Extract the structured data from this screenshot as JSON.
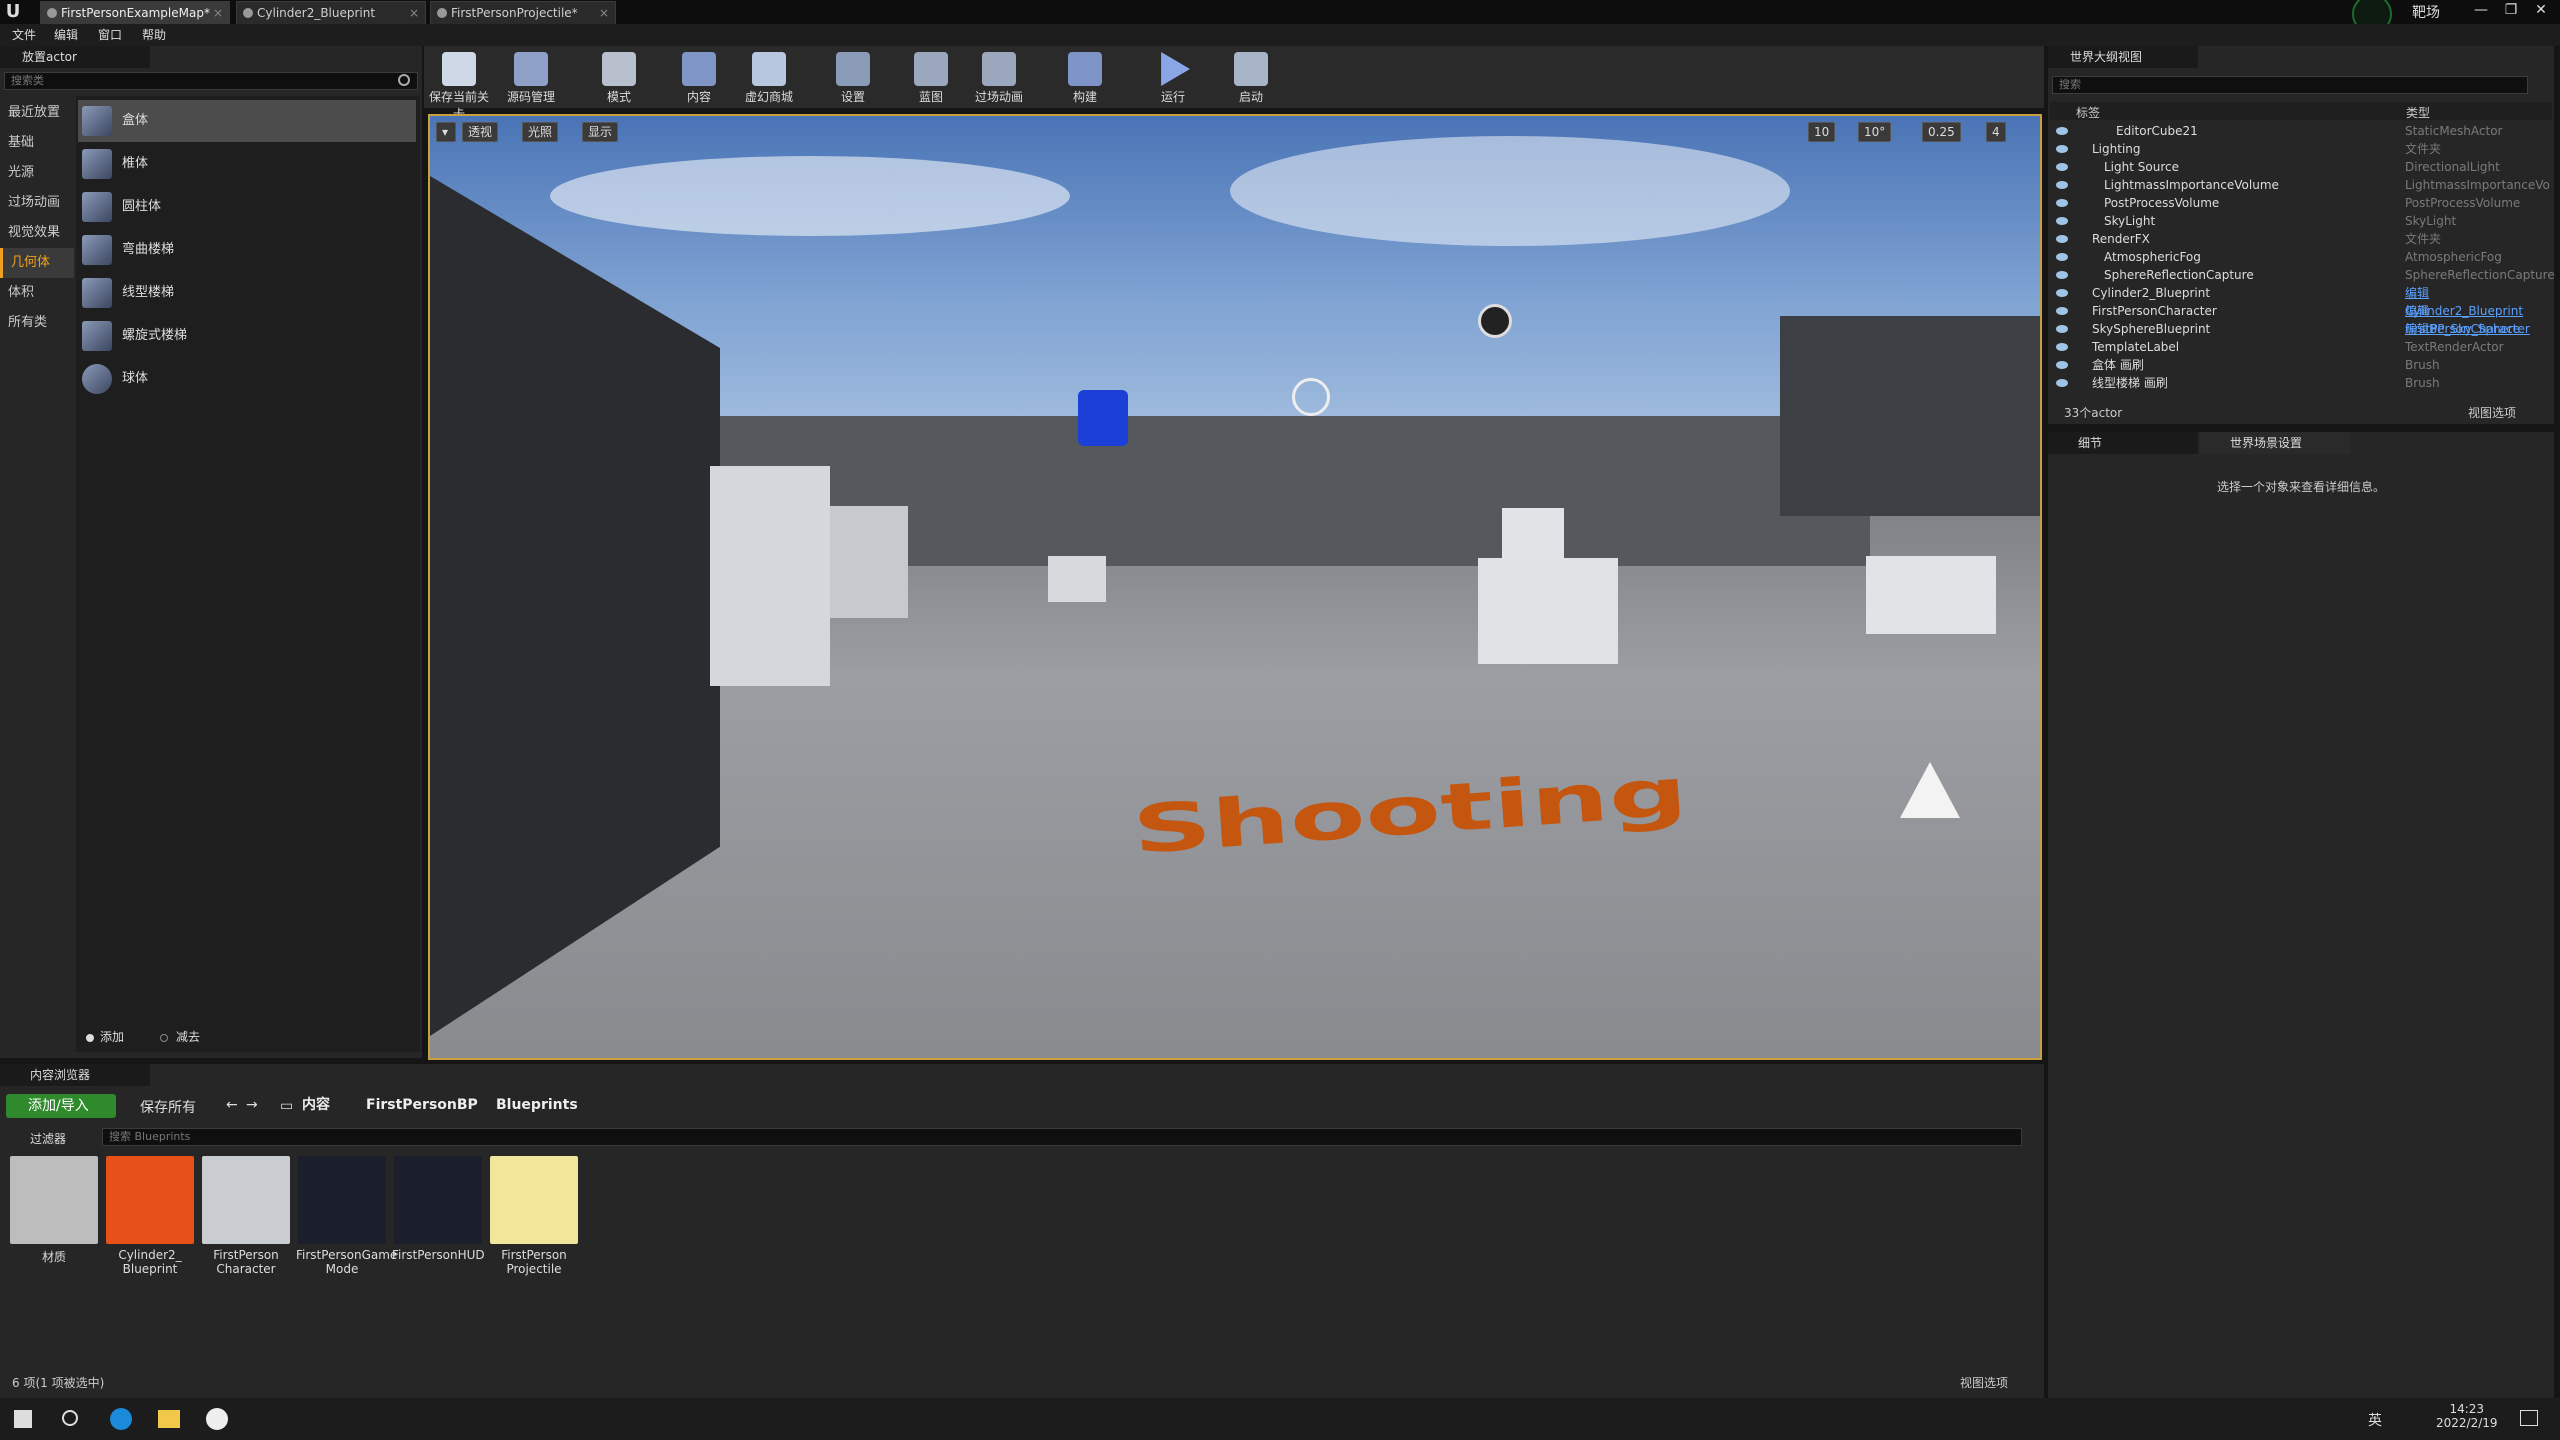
{
  "window": {
    "logo": "U",
    "tabs": [
      {
        "label": "FirstPersonExampleMap*"
      },
      {
        "label": "Cylinder2_Blueprint"
      },
      {
        "label": "FirstPersonProjectile*"
      }
    ],
    "project_label": "靶场",
    "controls": [
      "—",
      "❐",
      "✕"
    ]
  },
  "menu": {
    "items": [
      "文件",
      "编辑",
      "窗口",
      "帮助"
    ]
  },
  "place_panel": {
    "tab": "放置actor",
    "search_placeholder": "搜索类",
    "categories": [
      "最近放置",
      "基础",
      "光源",
      "过场动画",
      "视觉效果",
      "几何体",
      "体积",
      "所有类"
    ],
    "selected_category": "几何体",
    "items": [
      "盒体",
      "椎体",
      "圆柱体",
      "弯曲楼梯",
      "线型楼梯",
      "螺旋式楼梯",
      "球体"
    ],
    "add_label": "添加",
    "subtract_label": "减去"
  },
  "toolbar": {
    "buttons": [
      "保存当前关卡",
      "源码管理",
      "模式",
      "内容",
      "虚幻商城",
      "设置",
      "蓝图",
      "过场动画",
      "构建",
      "运行",
      "启动"
    ]
  },
  "viewport": {
    "perspective": "透视",
    "lit": "光照",
    "show": "显示",
    "grid": "10",
    "rotation": "10°",
    "scale": "0.25",
    "camera_speed": "4",
    "floor_text": "Shooting"
  },
  "outliner": {
    "tab": "世界大纲视图",
    "search_placeholder": "搜索",
    "col_label": "标签",
    "col_type": "类型",
    "rows": [
      {
        "name": "EditorCube21",
        "type": "StaticMeshActor",
        "indent": 3
      },
      {
        "name": "Lighting",
        "type": "文件夹",
        "indent": 1,
        "folder": true
      },
      {
        "name": "Light Source",
        "type": "DirectionalLight",
        "indent": 2
      },
      {
        "name": "LightmassImportanceVolume",
        "type": "LightmassImportanceVo",
        "indent": 2
      },
      {
        "name": "PostProcessVolume",
        "type": "PostProcessVolume",
        "indent": 2
      },
      {
        "name": "SkyLight",
        "type": "SkyLight",
        "indent": 2
      },
      {
        "name": "RenderFX",
        "type": "文件夹",
        "indent": 1,
        "folder": true
      },
      {
        "name": "AtmosphericFog",
        "type": "AtmosphericFog",
        "indent": 2
      },
      {
        "name": "SphereReflectionCapture",
        "type": "SphereReflectionCapture",
        "indent": 2
      },
      {
        "name": "Cylinder2_Blueprint",
        "type": "编辑Cylinder2_Blueprint",
        "indent": 1,
        "link": true
      },
      {
        "name": "FirstPersonCharacter",
        "type": "编辑FirstPersonCharacter",
        "indent": 1,
        "link": true
      },
      {
        "name": "SkySphereBlueprint",
        "type": "编辑BP_Sky_Sphere",
        "indent": 1,
        "link": true
      },
      {
        "name": "TemplateLabel",
        "type": "TextRenderActor",
        "indent": 1
      },
      {
        "name": "盒体 画刷",
        "type": "Brush",
        "indent": 1
      },
      {
        "name": "线型楼梯 画刷",
        "type": "Brush",
        "indent": 1
      }
    ],
    "count": "33个actor",
    "view_options": "视图选项"
  },
  "details": {
    "tab": "细节",
    "tab2": "世界场景设置",
    "empty_message": "选择一个对象来查看详细信息。"
  },
  "content_browser": {
    "tab": "内容浏览器",
    "add_import": "添加/导入",
    "save_all": "保存所有",
    "breadcrumb": [
      "内容",
      "FirstPersonBP",
      "Blueprints"
    ],
    "filter": "过滤器",
    "search_placeholder": "搜索 Blueprints",
    "assets": [
      {
        "label": "材质",
        "color": "#bdbdbd"
      },
      {
        "label": "Cylinder2_ Blueprint",
        "color": "#e8501a"
      },
      {
        "label": "FirstPerson Character",
        "color": "#c9cdd2"
      },
      {
        "label": "FirstPersonGame Mode",
        "color": "#1b1f2c"
      },
      {
        "label": "FirstPersonHUD",
        "color": "#1b1f2c"
      },
      {
        "label": "FirstPerson Projectile",
        "color": "#f2e69a"
      }
    ],
    "status": "6 项(1 项被选中)",
    "view_options": "视图选项"
  },
  "taskbar": {
    "time": "14:23",
    "date": "2022/2/19",
    "ime": "英"
  }
}
